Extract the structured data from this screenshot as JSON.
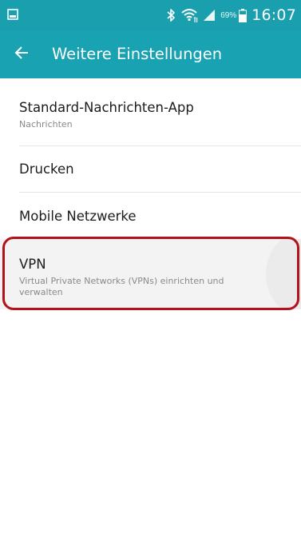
{
  "status_bar": {
    "left_icon": "image-icon",
    "icons": [
      "bluetooth-icon",
      "wifi-icon",
      "signal-icon",
      "battery-icon"
    ],
    "battery_percent": "69%",
    "time": "16:07",
    "bar_color": "#1a9fae"
  },
  "header": {
    "back_icon": "arrow-left-icon",
    "title": "Weitere Einstellungen",
    "color": "#18a2b2"
  },
  "list": {
    "items": [
      {
        "title": "Standard-Nachrichten-App",
        "subtitle": "Nachrichten"
      },
      {
        "title": "Drucken"
      },
      {
        "title": "Mobile Netzwerke"
      },
      {
        "title": "VPN",
        "subtitle": "Virtual Private Networks (VPNs) einrichten und verwalten"
      }
    ]
  },
  "highlight": {
    "target": "VPN",
    "color": "#b4121b"
  }
}
